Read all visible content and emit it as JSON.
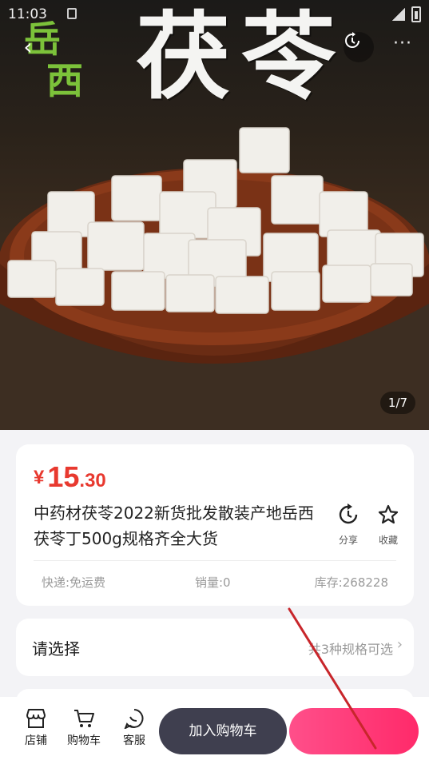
{
  "status_bar": {
    "time": "11:03"
  },
  "hero": {
    "title": "茯苓",
    "tag_line1": "岳",
    "tag_line2": "西",
    "counter": "1/7"
  },
  "product": {
    "price_symbol": "¥",
    "price_int": "15",
    "price_dec": ".30",
    "title": "中药材茯苓2022新货批发散装产地岳西茯苓丁500g规格齐全大货",
    "share_label": "分享",
    "favorite_label": "收藏",
    "shipping": "快递:免运费",
    "sales": "销量:0",
    "stock": "库存:268228"
  },
  "spec": {
    "label": "请选择",
    "hint": "共3种规格可选"
  },
  "bottom_bar": {
    "shop_label": "店铺",
    "cart_label": "购物车",
    "service_label": "客服",
    "add_to_cart_label": "加入购物车"
  },
  "colors": {
    "price": "#e8392f",
    "cart_button": "#3f3f4f",
    "buy_button": "#ff2a6a",
    "annotation": "#c8262b"
  },
  "icons": [
    "back-icon",
    "refresh-share-icon",
    "more-icon",
    "star-icon",
    "shop-icon",
    "cart-icon",
    "chat-icon",
    "chevron-right-icon"
  ]
}
